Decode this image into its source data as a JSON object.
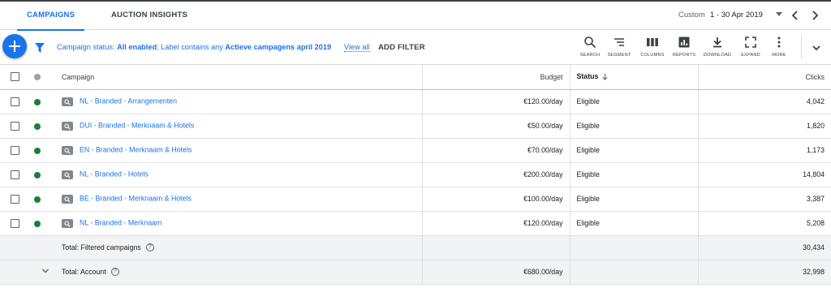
{
  "tabs": [
    {
      "label": "CAMPAIGNS",
      "active": true
    },
    {
      "label": "AUCTION INSIGHTS",
      "active": false
    }
  ],
  "date_range": {
    "label": "Custom",
    "value": "1 - 30 Apr 2019"
  },
  "filter_bar": {
    "status_prefix": "Campaign status: ",
    "status_value": "All enabled",
    "label_prefix": "; Label contains any ",
    "label_value": "Actieve campagens april 2019",
    "view_all": "View all",
    "add_filter": "ADD FILTER"
  },
  "toolbar": [
    {
      "label": "SEARCH",
      "icon": "search-icon"
    },
    {
      "label": "SEGMENT",
      "icon": "segment-icon"
    },
    {
      "label": "COLUMNS",
      "icon": "columns-icon"
    },
    {
      "label": "REPORTS",
      "icon": "reports-icon"
    },
    {
      "label": "DOWNLOAD",
      "icon": "download-icon"
    },
    {
      "label": "EXPAND",
      "icon": "expand-icon"
    },
    {
      "label": "MORE",
      "icon": "more-vert-icon"
    }
  ],
  "table": {
    "headers": {
      "campaign": "Campaign",
      "budget": "Budget",
      "status": "Status",
      "clicks": "Clicks"
    },
    "rows": [
      {
        "campaign": "NL - Branded - Arrangementen",
        "budget": "€120.00/day",
        "status": "Eligible",
        "clicks": "4,042"
      },
      {
        "campaign": "DUI - Branded - Merknaam & Hotels",
        "budget": "€50.00/day",
        "status": "Eligible",
        "clicks": "1,820"
      },
      {
        "campaign": "EN - Branded - Merknaam & Hotels",
        "budget": "€70.00/day",
        "status": "Eligible",
        "clicks": "1,173"
      },
      {
        "campaign": "NL - Branded - Hotels",
        "budget": "€200.00/day",
        "status": "Eligible",
        "clicks": "14,804"
      },
      {
        "campaign": "BE - Branded - Merknaam & Hotels",
        "budget": "€100.00/day",
        "status": "Eligible",
        "clicks": "3,387"
      },
      {
        "campaign": "NL - Branded - Merknaam",
        "budget": "€120.00/day",
        "status": "Eligible",
        "clicks": "5,208"
      }
    ],
    "totals": [
      {
        "label": "Total: Filtered campaigns",
        "budget": "",
        "clicks": "30,434"
      },
      {
        "label": "Total: Account",
        "budget": "€680.00/day",
        "clicks": "32,998"
      }
    ]
  },
  "colors": {
    "accent": "#1a73e8",
    "status_enabled": "#188038"
  }
}
